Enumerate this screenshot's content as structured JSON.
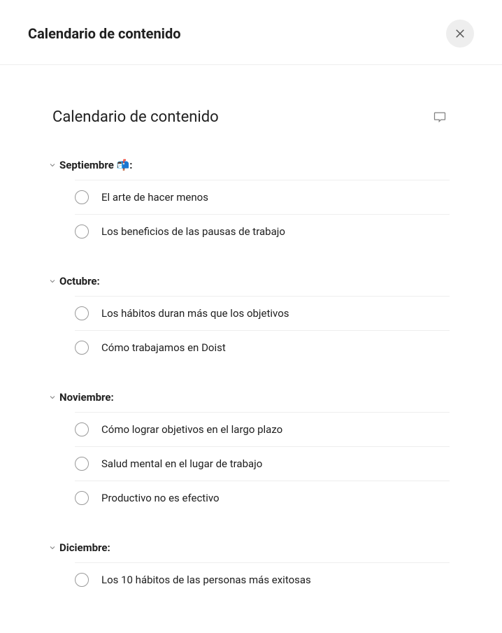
{
  "header": {
    "title": "Calendario de contenido"
  },
  "content": {
    "title": "Calendario de contenido"
  },
  "sections": [
    {
      "title": "Septiembre 📬:",
      "tasks": [
        {
          "title": "El arte de hacer menos"
        },
        {
          "title": "Los beneficios de las pausas de trabajo"
        }
      ]
    },
    {
      "title": "Octubre:",
      "tasks": [
        {
          "title": "Los hábitos duran más que los objetivos"
        },
        {
          "title": "Cómo trabajamos en Doist"
        }
      ]
    },
    {
      "title": "Noviembre:",
      "tasks": [
        {
          "title": "Cómo lograr objetivos en el largo plazo"
        },
        {
          "title": "Salud mental en el lugar de trabajo"
        },
        {
          "title": "Productivo no es efectivo"
        }
      ]
    },
    {
      "title": "Diciembre:",
      "tasks": [
        {
          "title": "Los 10 hábitos de las personas más exitosas"
        }
      ]
    }
  ]
}
